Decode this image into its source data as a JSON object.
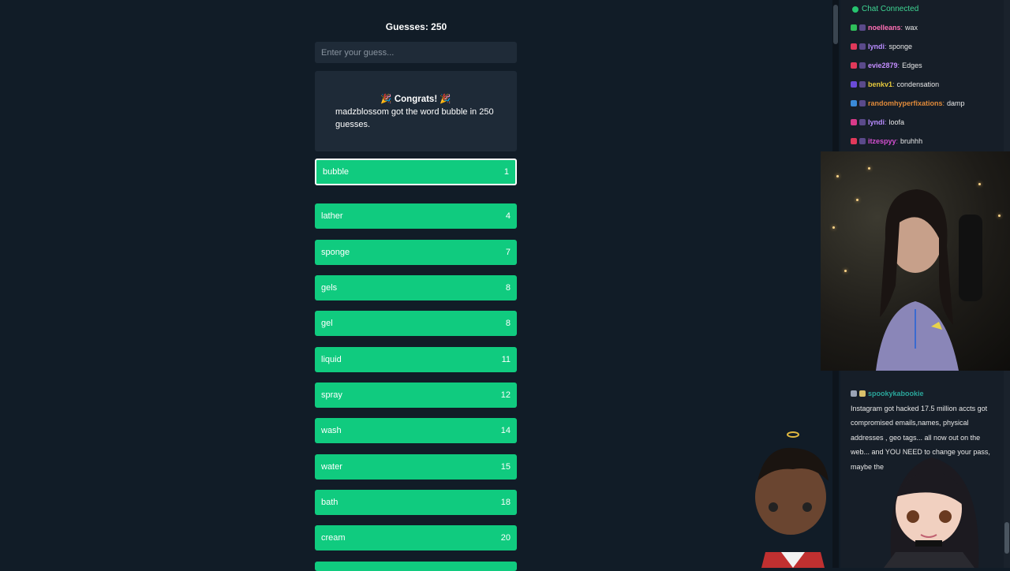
{
  "game": {
    "guesses_label": "Guesses: 250",
    "input_placeholder": "Enter your guess...",
    "congrats_title": "🎉 Congrats! 🎉",
    "congrats_message": "madzblossom got the word bubble in 250 guesses.",
    "words": [
      {
        "word": "bubble",
        "rank": "1"
      },
      {
        "word": "lather",
        "rank": "4"
      },
      {
        "word": "sponge",
        "rank": "7"
      },
      {
        "word": "gels",
        "rank": "8"
      },
      {
        "word": "gel",
        "rank": "8"
      },
      {
        "word": "liquid",
        "rank": "11"
      },
      {
        "word": "spray",
        "rank": "12"
      },
      {
        "word": "wash",
        "rank": "14"
      },
      {
        "word": "water",
        "rank": "15"
      },
      {
        "word": "bath",
        "rank": "18"
      },
      {
        "word": "cream",
        "rank": "20"
      }
    ]
  },
  "chat": {
    "status": "Chat Connected",
    "messages": [
      {
        "user": "noelleans",
        "text": "wax",
        "color": "#ff6fb5"
      },
      {
        "user": "lyndi",
        "text": "sponge",
        "color": "#b98cff"
      },
      {
        "user": "evie2879",
        "text": "Edges",
        "color": "#c48dff"
      },
      {
        "user": "benkv1",
        "text": "condensation",
        "color": "#e6c93c"
      },
      {
        "user": "randomhyperfixations",
        "text": "damp",
        "color": "#e08a3a"
      },
      {
        "user": "lyndi",
        "text": "loofa",
        "color": "#b98cff"
      },
      {
        "user": "itzespyy",
        "text": "bruhhh",
        "color": "#d44fd0"
      }
    ],
    "long_user": "spookykabookie",
    "long_message": "Instagram got hacked 17.5 million accts got compromised emails,names, physical addresses , geo tags... all now out on the web... and YOU NEED to change your pass, maybe the"
  },
  "colors": {
    "background": "#111c27",
    "word_row": "#10cb7f",
    "panel": "#1e2a37"
  }
}
